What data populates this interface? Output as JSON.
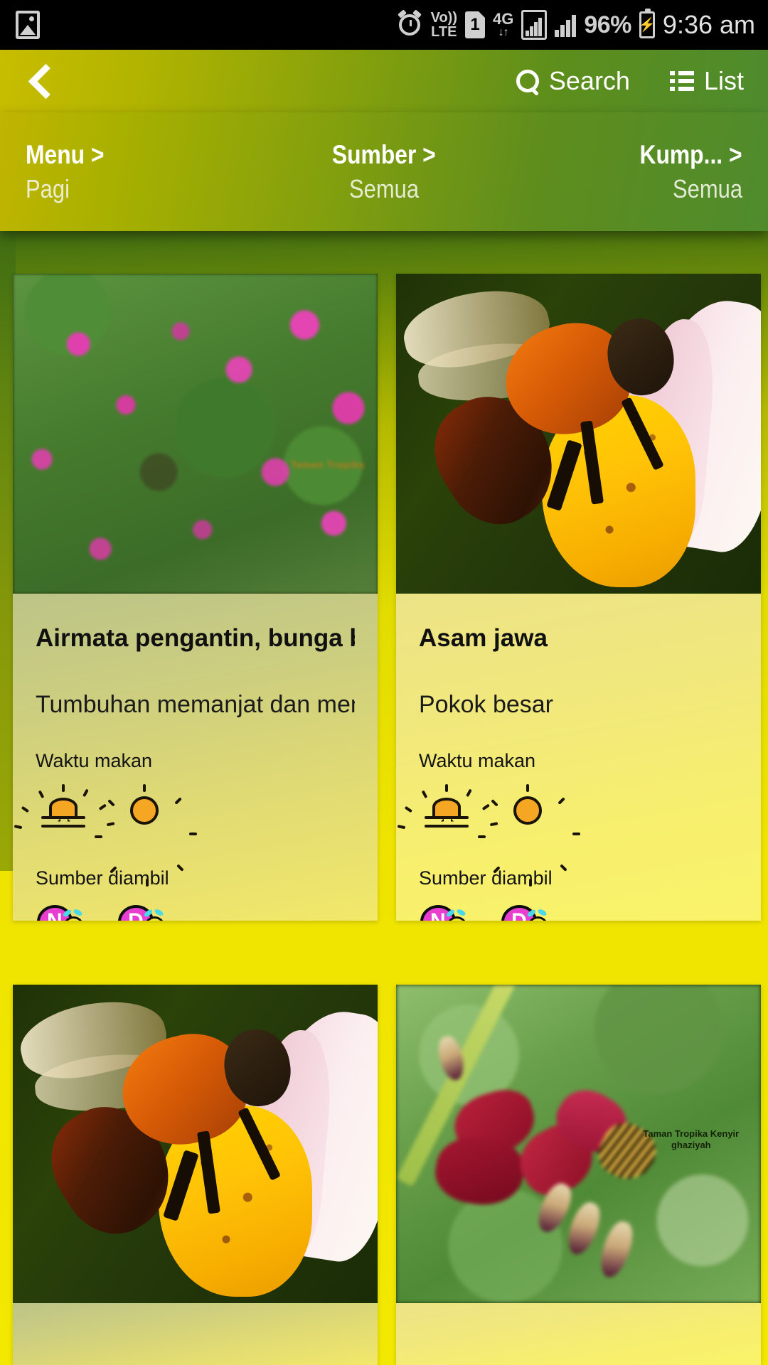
{
  "status_bar": {
    "gallery_icon": "gallery-icon",
    "alarm_icon": "alarm-clock-icon",
    "volte_line1": "Vo))",
    "volte_line2": "LTE",
    "sim_slot": "1",
    "network_type": "4G",
    "network_arrows": "↓↑",
    "battery_percent": "96%",
    "battery_icon": "battery-charging-icon",
    "time": "9:36 am"
  },
  "toolbar": {
    "back_icon": "back-chevron-icon",
    "search_icon": "search-icon",
    "search_label": "Search",
    "list_icon": "list-icon",
    "list_label": "List"
  },
  "filters": [
    {
      "title": "Menu >",
      "value": "Pagi"
    },
    {
      "title": "Sumber >",
      "value": "Semua"
    },
    {
      "title": "Kump... >",
      "value": "Semua"
    }
  ],
  "cards": [
    {
      "title": "Airmata pengantin, bunga berteh",
      "description": "Tumbuhan memanjat dan menjal…",
      "feeding_label": "Waktu makan",
      "feeding_icons": [
        "sunrise-icon",
        "sun-icon"
      ],
      "source_label": "Sumber diambil",
      "source_icons": [
        {
          "name": "bee-source-n-icon",
          "letter": "N"
        },
        {
          "name": "bee-source-d-icon",
          "letter": "D"
        }
      ],
      "photo": "pink-flowering-shrub-photo",
      "photo_watermark": "Taman Tropika"
    },
    {
      "title": "Asam jawa",
      "description": "Pokok besar",
      "feeding_label": "Waktu makan",
      "feeding_icons": [
        "sunrise-icon",
        "sun-icon"
      ],
      "source_label": "Sumber diambil",
      "source_icons": [
        {
          "name": "bee-source-n-icon",
          "letter": "N"
        },
        {
          "name": "bee-source-d-icon",
          "letter": "D"
        }
      ],
      "photo": "orange-bee-on-yellow-flower-photo",
      "photo_watermark": ""
    },
    {
      "title": "",
      "description": "",
      "photo": "orange-bee-on-yellow-flower-photo",
      "photo_watermark": ""
    },
    {
      "title": "",
      "description": "",
      "photo": "red-flower-with-honeybee-photo",
      "photo_watermark": "Taman Tropika Kenyir\nghaziyah"
    }
  ],
  "colors": {
    "header_start": "#c2b800",
    "header_end": "#4e8b2d",
    "page_background": "#f2e800",
    "card_left": "#d6d67c",
    "card_right": "#f4ec74",
    "accent_magenta": "#e83fd0",
    "sun_orange": "#f5a623"
  }
}
